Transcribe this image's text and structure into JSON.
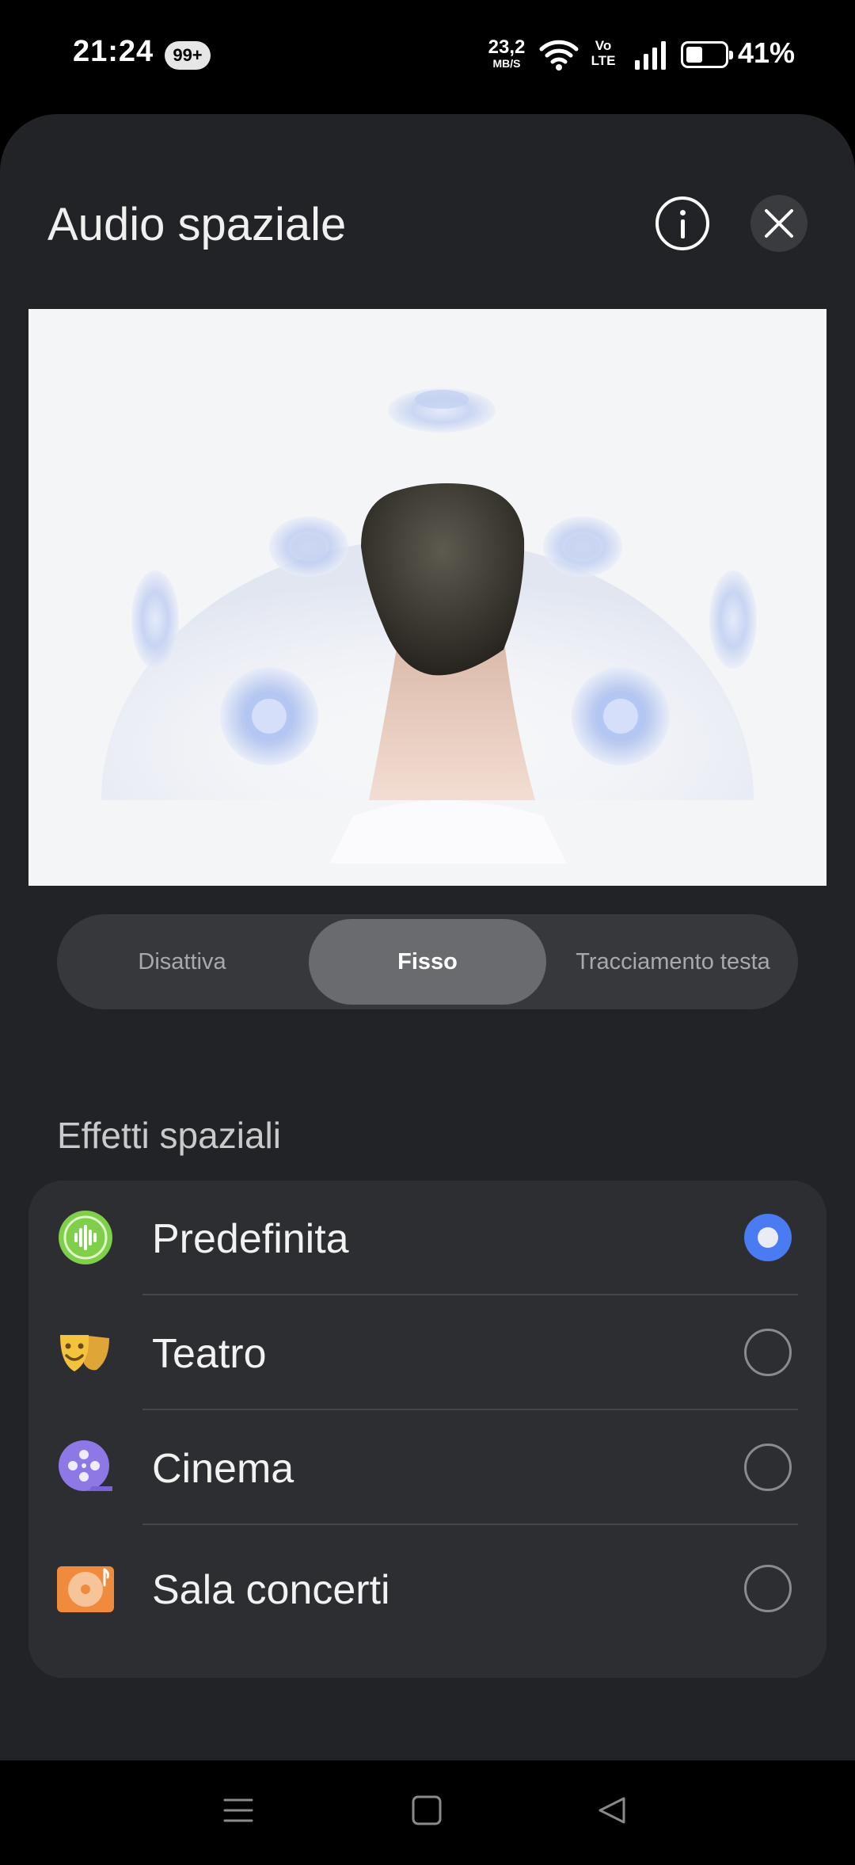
{
  "status_bar": {
    "time": "21:24",
    "notification_badge": "99+",
    "net_speed_value": "23,2",
    "net_speed_unit": "MB/S",
    "volte_top": "Vo",
    "volte_bottom": "LTE",
    "battery_percent": "41%"
  },
  "sheet": {
    "title": "Audio spaziale",
    "info_icon": "info-icon",
    "close_icon": "close-icon"
  },
  "mode_selector": {
    "options": [
      "Disattiva",
      "Fisso",
      "Tracciamento testa"
    ],
    "selected": "Fisso"
  },
  "spatial_effects": {
    "section_title": "Effetti spaziali",
    "items": [
      {
        "label": "Predefinita",
        "icon": "sound-wave-icon",
        "selected": true
      },
      {
        "label": "Teatro",
        "icon": "theater-masks-icon",
        "selected": false
      },
      {
        "label": "Cinema",
        "icon": "film-reel-icon",
        "selected": false
      },
      {
        "label": "Sala concerti",
        "icon": "vinyl-record-icon",
        "selected": false
      }
    ]
  },
  "colors": {
    "accent": "#4a7bf2",
    "sheet_background": "#222326",
    "card_background": "#2d2e32"
  },
  "nav_bar": [
    "menu-icon",
    "home-icon",
    "back-icon"
  ]
}
